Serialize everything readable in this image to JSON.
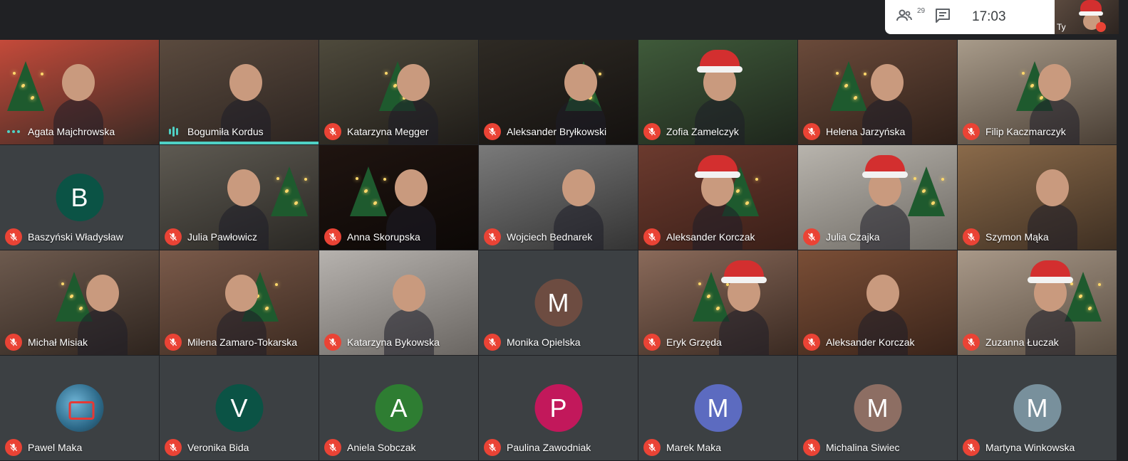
{
  "topbar": {
    "participants_count": "29",
    "time": "17:03",
    "icons": [
      "people-icon",
      "chat-icon"
    ]
  },
  "self_view": {
    "label": "Ty",
    "muted": true
  },
  "colors": {
    "muted": "#ea4335",
    "speaking": "#4fd1c5",
    "background": "#202124"
  },
  "participants": [
    {
      "name": "Agata Majchrowska",
      "status": "dots"
    },
    {
      "name": "Bogumiła Kordus",
      "status": "speaking"
    },
    {
      "name": "Katarzyna Megger",
      "status": "muted"
    },
    {
      "name": "Aleksander Bryłkowski",
      "status": "muted"
    },
    {
      "name": "Zofia Zamelczyk",
      "status": "muted"
    },
    {
      "name": "Helena Jarzyńska",
      "status": "muted"
    },
    {
      "name": "Filip Kaczmarczyk",
      "status": "muted"
    },
    {
      "name": "Baszyński Władysław",
      "status": "muted",
      "initial": "B",
      "avatar_color": "#0b5345"
    },
    {
      "name": "Julia Pawłowicz",
      "status": "muted"
    },
    {
      "name": "Anna Skorupska",
      "status": "muted"
    },
    {
      "name": "Wojciech Bednarek",
      "status": "muted"
    },
    {
      "name": "Aleksander Korczak",
      "status": "muted"
    },
    {
      "name": "Julia Czajka",
      "status": "muted"
    },
    {
      "name": "Szymon Mąka",
      "status": "muted"
    },
    {
      "name": "Michał Misiak",
      "status": "muted"
    },
    {
      "name": "Milena Zamaro-Tokarska",
      "status": "muted"
    },
    {
      "name": "Katarzyna Bykowska",
      "status": "muted"
    },
    {
      "name": "Monika Opielska",
      "status": "muted",
      "initial": "M",
      "avatar_color": "#6d4c41"
    },
    {
      "name": "Eryk Grzęda",
      "status": "muted"
    },
    {
      "name": "Aleksander Korczak",
      "status": "muted"
    },
    {
      "name": "Zuzanna Łuczak",
      "status": "muted"
    },
    {
      "name": "Pawel Maka",
      "status": "muted",
      "avatar_photo": true
    },
    {
      "name": "Veronika Bida",
      "status": "muted",
      "initial": "V",
      "avatar_color": "#0b5345"
    },
    {
      "name": "Aniela Sobczak",
      "status": "muted",
      "initial": "A",
      "avatar_color": "#2e7d32"
    },
    {
      "name": "Paulina Zawodniak",
      "status": "muted",
      "initial": "P",
      "avatar_color": "#c2185b"
    },
    {
      "name": "Marek Maka",
      "status": "muted",
      "initial": "M",
      "avatar_color": "#5c6bc0"
    },
    {
      "name": "Michalina Siwiec",
      "status": "muted",
      "initial": "M",
      "avatar_color": "#8d6e63"
    },
    {
      "name": "Martyna Winkowska",
      "status": "muted",
      "initial": "M",
      "avatar_color": "#78909c"
    }
  ]
}
